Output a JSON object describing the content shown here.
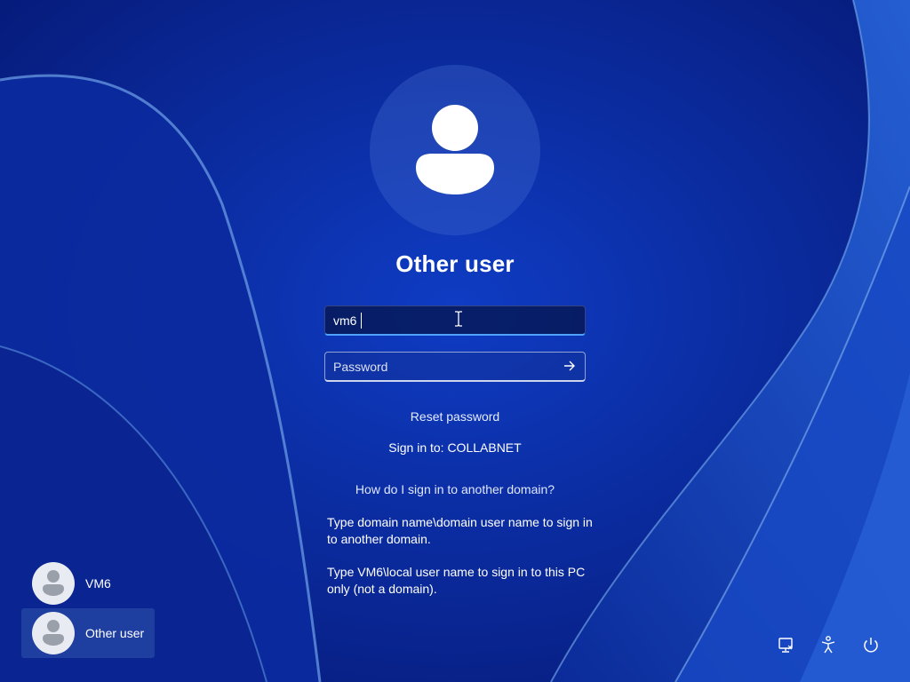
{
  "login": {
    "title": "Other user",
    "username_value": "vm6",
    "password_placeholder": "Password",
    "reset_password": "Reset password",
    "sign_in_to": "Sign in to: COLLABNET",
    "help_link": "How do I sign in to another domain?",
    "help_text_1": "Type domain name\\domain user name to sign in to another domain.",
    "help_text_2": "Type VM6\\local user name to sign in to this PC only (not a domain)."
  },
  "users": [
    {
      "name": "VM6",
      "selected": false
    },
    {
      "name": "Other user",
      "selected": true
    }
  ],
  "system_buttons": [
    "network-icon",
    "accessibility-icon",
    "power-icon"
  ],
  "colors": {
    "background": "#0a2fa6",
    "focus_underline": "#4fa3ff"
  }
}
